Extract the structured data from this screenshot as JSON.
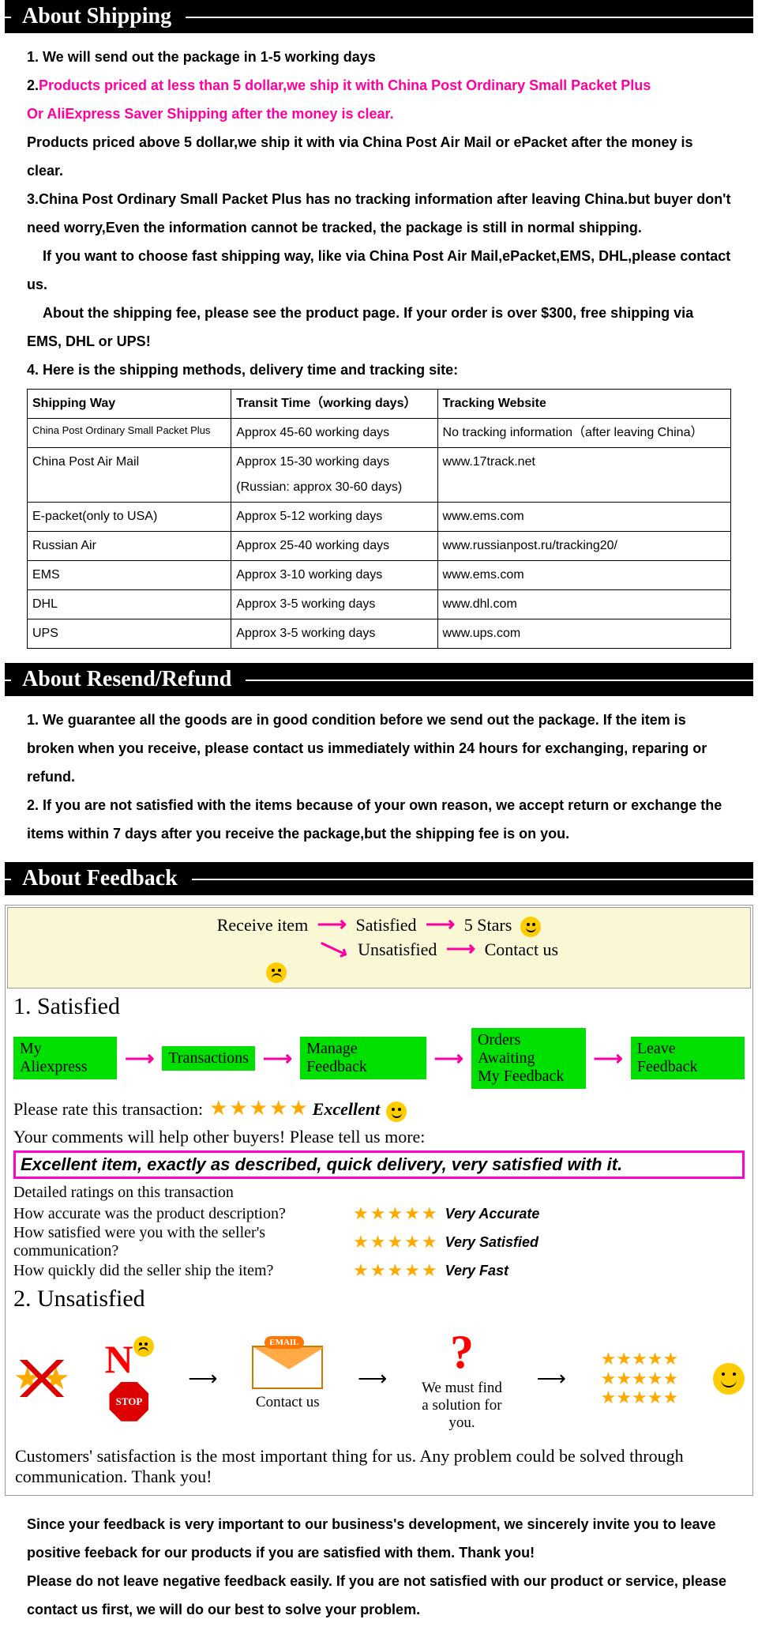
{
  "sections": {
    "shipping": {
      "title": "About Shipping"
    },
    "refund": {
      "title": "About Resend/Refund"
    },
    "feedback": {
      "title": "About Feedback"
    }
  },
  "shipping": {
    "p1": "1. We will send out the package in 1-5 working days",
    "p2a": "2.",
    "p2b": "Products priced at less than 5 dollar,we ship it with China Post Ordinary Small Packet Plus",
    "p2c": " Or AliExpress Saver Shipping after the money is clear.",
    "p3": "Products priced above 5 dollar,we ship it with via China Post Air Mail or ePacket after the money is clear.",
    "p4": "3.China Post Ordinary Small Packet Plus has no tracking information after leaving China.but buyer don't need worry,Even the information cannot be tracked, the package is still in normal shipping.",
    "p5": "    If you want to choose fast shipping way, like via China Post Air Mail,ePacket,EMS, DHL,please contact us.",
    "p6": "    About the shipping fee, please see the product page. If your order is over $300, free shipping via EMS, DHL or UPS!",
    "p7": "4. Here is the shipping methods, delivery time and tracking site:",
    "th": [
      "Shipping Way",
      "Transit Time（working days）",
      "Tracking Website"
    ],
    "rows": [
      [
        "China Post Ordinary Small Packet Plus",
        "Approx 45-60 working days",
        "No tracking information（after leaving China）"
      ],
      [
        "China Post Air Mail",
        "Approx 15-30 working days\n(Russian: approx 30-60 days)",
        "www.17track.net"
      ],
      [
        "E-packet(only to USA)",
        "Approx 5-12 working days",
        "www.ems.com"
      ],
      [
        "Russian Air",
        "Approx 25-40 working days",
        "www.russianpost.ru/tracking20/"
      ],
      [
        "EMS",
        "Approx 3-10 working days",
        "www.ems.com"
      ],
      [
        "DHL",
        "Approx 3-5 working days",
        "www.dhl.com"
      ],
      [
        "UPS",
        "Approx 3-5 working days",
        "www.ups.com"
      ]
    ]
  },
  "refund": {
    "p1": "1. We guarantee all the goods are in good condition before we send out the package. If the item is broken when you receive, please contact us immediately within 24 hours for exchanging, reparing or refund.",
    "p2": "2. If you are not satisfied with the items because of your own reason, we accept return or exchange the items within 7 days after you receive the package,but the shipping fee is on you."
  },
  "feedback": {
    "flow": {
      "receive": "Receive item",
      "satisfied": "Satisfied",
      "fivestars": "5 Stars",
      "unsatisfied": "Unsatisfied",
      "contact": "Contact us"
    },
    "h1": "1. Satisfied",
    "steps": [
      "My Aliexpress",
      "Transactions",
      "Manage Feedback",
      "Orders Awaiting\nMy Feedback",
      "Leave Feedback"
    ],
    "rate_label": "Please rate this transaction:",
    "excellent": "Excellent",
    "comments_help": "Your comments will help other buyers! Please tell us more:",
    "comment": "Excellent item, exactly as described, quick delivery, very satisfied with it.",
    "detail_head": "Detailed ratings on this transaction",
    "q1": "How accurate was the product description?",
    "q2": "How satisfied were you with the seller's communication?",
    "q3": "How quickly did the seller ship the item?",
    "a1": "Very Accurate",
    "a2": "Very Satisfied",
    "a3": "Very Fast",
    "h2": "2. Unsatisfied",
    "no": "N",
    "stop": "STOP",
    "email": "EMAIL",
    "contactus": "Contact us",
    "solution": "We must find\na solution for\nyou.",
    "closing": "Customers' satisfaction is the most important thing for us. Any problem could be solved through communication. Thank you!",
    "foot1": "Since your feedback is very important to our business's development, we sincerely invite you to leave positive feeback for our products if you are satisfied with them. Thank you!",
    "foot2": "Please do not leave negative feedback easily. If you are not satisfied with our product or service, please contact us first, we will do our best to solve your problem."
  }
}
